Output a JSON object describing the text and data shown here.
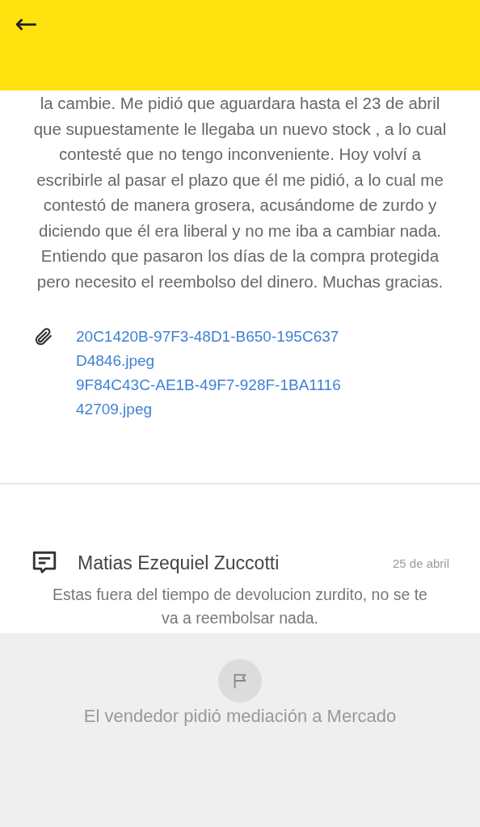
{
  "header": {
    "back": "←"
  },
  "message": {
    "text": "la cambie. Me pidió que aguardara hasta el 23 de abril que supuestamente le llegaba un nuevo stock , a lo cual contesté que no tengo inconveniente. Hoy volví a escribirle al pasar el plazo que él me pidió, a lo cual me contestó de manera grosera, acusándome de zurdo y diciendo que él era liberal y no me iba a cambiar nada. Entiendo que pasaron los días de la compra protegida pero necesito el reembolso del dinero. Muchas gracias.",
    "attachments": [
      "20C1420B-97F3-48D1-B650-195C637D4846.jpeg",
      "9F84C43C-AE1B-49F7-928F-1BA111642709.jpeg"
    ]
  },
  "reply": {
    "author": "Matias Ezequiel Zuccotti",
    "date": "25 de abril",
    "text": "Estas fuera del tiempo de devolucion zurdito, no se te va a reembolsar nada."
  },
  "notice": {
    "text": "El vendedor pidió mediación a Mercado"
  }
}
